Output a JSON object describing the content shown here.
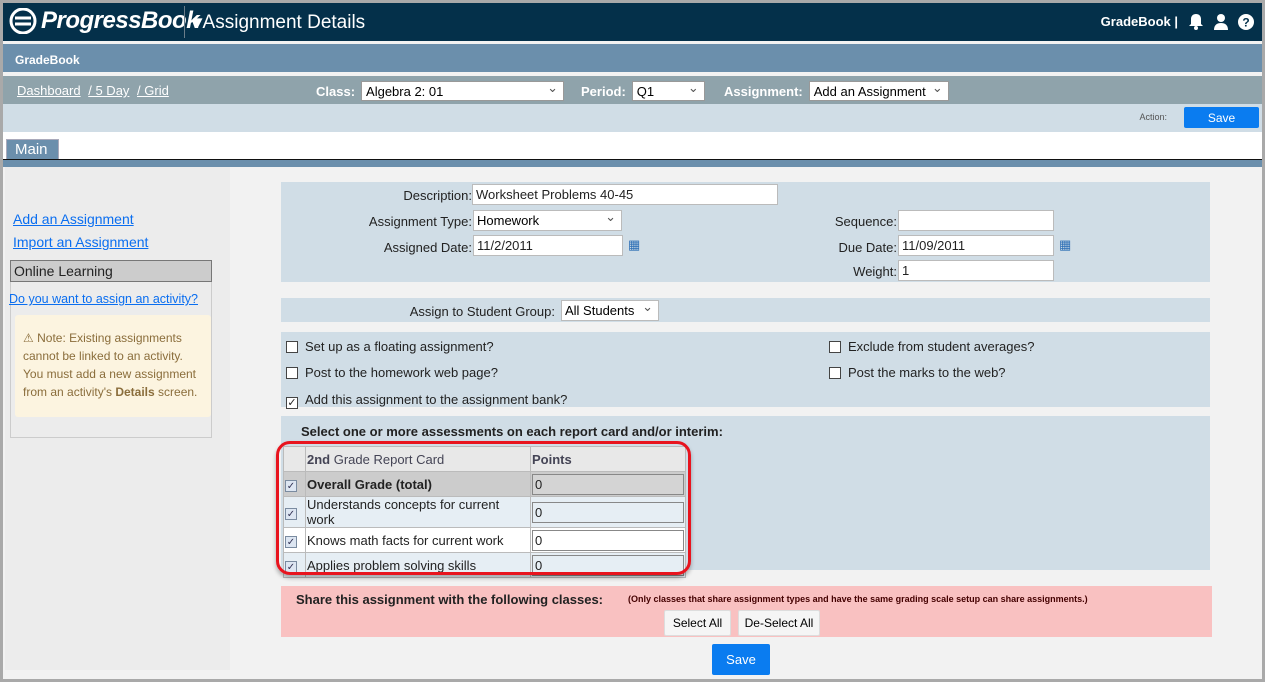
{
  "header": {
    "logo": "ProgressBook",
    "title": "Assignment Details",
    "app_link": "GradeBook |",
    "icons": [
      "bell-icon",
      "user-icon",
      "help-icon"
    ]
  },
  "subheader": {
    "title": "GradeBook"
  },
  "nav": {
    "breadcrumbs": [
      "Dashboard",
      "/ 5 Day",
      "/ Grid"
    ],
    "class_label": "Class:",
    "class_value": "Algebra 2: 01",
    "period_label": "Period:",
    "period_value": "Q1",
    "assignment_label": "Assignment:",
    "assignment_value": "Add an Assignment"
  },
  "action": {
    "label": "Action:",
    "save": "Save"
  },
  "tabs": [
    {
      "label": "Main",
      "active": true
    }
  ],
  "sidebar": {
    "links": [
      "Add an Assignment",
      "Import an Assignment"
    ],
    "section": "Online Learning",
    "activity_link": "Do you want to assign an activity?",
    "note_pre": "Note: Existing assignments cannot be linked to an activity. You must add a new assignment from an activity's ",
    "note_bold": "Details",
    "note_post": " screen."
  },
  "form": {
    "description_label": "Description:",
    "description": "Worksheet Problems 40-45",
    "type_label": "Assignment Type:",
    "type": "Homework",
    "assigned_label": "Assigned Date:",
    "assigned": "11/2/2011",
    "sequence_label": "Sequence:",
    "sequence": "",
    "due_label": "Due Date:",
    "due": "11/09/2011",
    "weight_label": "Weight:",
    "weight": "1",
    "group_label": "Assign to Student Group:",
    "group": "All Students"
  },
  "options": [
    {
      "label": "Set up as a floating assignment?",
      "checked": false
    },
    {
      "label": "Exclude from student averages?",
      "checked": false
    },
    {
      "label": "Post to the homework web page?",
      "checked": false
    },
    {
      "label": "Post the marks to the web?",
      "checked": false
    },
    {
      "label": "Add this assignment to the assignment bank?",
      "checked": true
    }
  ],
  "report_card": {
    "instruction": "Select one or more assessments on each report card and/or interim:",
    "header_bold": "2nd",
    "header_rest": " Grade Report Card",
    "points_header": "Points",
    "rows": [
      {
        "name": "Overall Grade (total)",
        "points": "0",
        "checked": true
      },
      {
        "name": "Understands concepts for current work",
        "points": "0",
        "checked": true
      },
      {
        "name": "Knows math facts for current work",
        "points": "0",
        "checked": true
      },
      {
        "name": "Applies problem solving skills",
        "points": "0",
        "checked": true
      }
    ]
  },
  "share": {
    "title": "Share this assignment with the following classes:",
    "note": "(Only classes that share assignment types and have the same grading scale setup can share assignments.)",
    "select_all": "Select All",
    "deselect_all": "De-Select All"
  },
  "footer": {
    "save": "Save"
  },
  "colors": {
    "header": "#04304a",
    "subheader": "#6b8fac",
    "accent": "#0a7cf0",
    "highlight": "#e8141e"
  }
}
